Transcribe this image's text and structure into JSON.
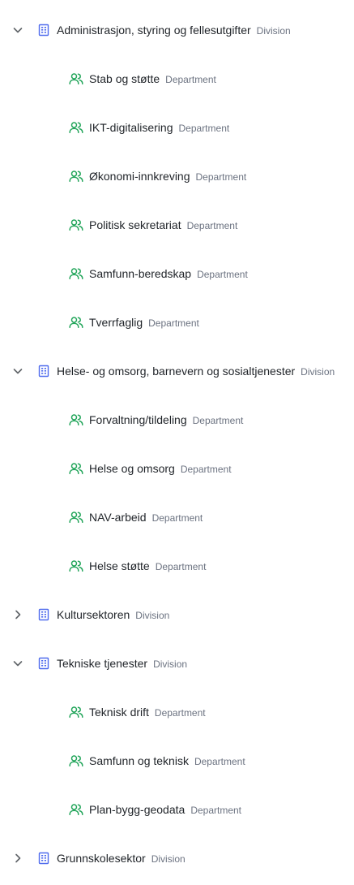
{
  "colors": {
    "division_icon": "#4f6bed",
    "department_icon": "#22a55a",
    "chevron": "#5f6368",
    "text": "#1f2328",
    "muted": "#6b7280"
  },
  "tree": [
    {
      "name": "Administrasjon, styring og fellesutgifter",
      "type": "Division",
      "expanded": true,
      "children": [
        {
          "name": "Stab og støtte",
          "type": "Department"
        },
        {
          "name": "IKT-digitalisering",
          "type": "Department"
        },
        {
          "name": "Økonomi-innkreving",
          "type": "Department"
        },
        {
          "name": "Politisk sekretariat",
          "type": "Department"
        },
        {
          "name": "Samfunn-beredskap",
          "type": "Department"
        },
        {
          "name": "Tverrfaglig",
          "type": "Department"
        }
      ]
    },
    {
      "name": "Helse- og omsorg, barnevern og sosialtjenester",
      "type": "Division",
      "expanded": true,
      "children": [
        {
          "name": "Forvaltning/tildeling",
          "type": "Department"
        },
        {
          "name": "Helse og omsorg",
          "type": "Department"
        },
        {
          "name": "NAV-arbeid",
          "type": "Department"
        },
        {
          "name": "Helse støtte",
          "type": "Department"
        }
      ]
    },
    {
      "name": "Kultursektoren",
      "type": "Division",
      "expanded": false,
      "children": []
    },
    {
      "name": "Tekniske tjenester",
      "type": "Division",
      "expanded": true,
      "children": [
        {
          "name": "Teknisk drift",
          "type": "Department"
        },
        {
          "name": "Samfunn og teknisk",
          "type": "Department"
        },
        {
          "name": "Plan-bygg-geodata",
          "type": "Department"
        }
      ]
    },
    {
      "name": "Grunnskolesektor",
      "type": "Division",
      "expanded": false,
      "children": []
    }
  ]
}
